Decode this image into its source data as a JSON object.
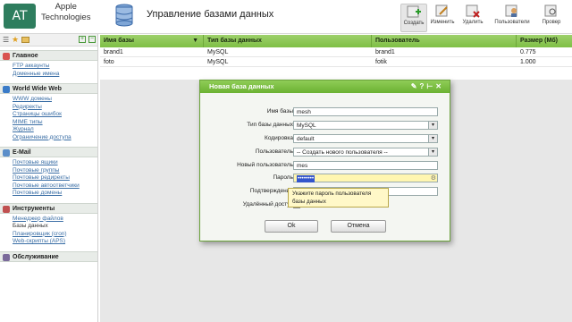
{
  "brand": {
    "logo": "AT",
    "line1": "Apple",
    "line2": "Technologies"
  },
  "page_title": "Управление базами данных",
  "toolbar": {
    "create": "Создать",
    "edit": "Изменить",
    "delete": "Удалить",
    "users": "Пользователи",
    "check": "Провер"
  },
  "sidebar": {
    "sections": [
      {
        "title": "Главное",
        "color": "#d9534f",
        "items": [
          "FTP аккаунты",
          "Доменные имена"
        ]
      },
      {
        "title": "World Wide Web",
        "color": "#3a7bc8",
        "items": [
          "WWW домены",
          "Редиректы",
          "Страницы ошибок",
          "MIME типы",
          "Журнал",
          "Ограничение доступа"
        ]
      },
      {
        "title": "E-Mail",
        "color": "#5b8ec9",
        "items": [
          "Почтовые ящики",
          "Почтовые группы",
          "Почтовые редиректы",
          "Почтовые автоответчики",
          "Почтовые домены"
        ]
      },
      {
        "title": "Инструменты",
        "color": "#c05050",
        "items": [
          "Менеджер файлов",
          "Базы данных",
          "Планировщик (cron)",
          "Web-скрипты (APS)"
        ]
      },
      {
        "title": "Обслуживание",
        "color": "#7a6a9a",
        "items": []
      }
    ]
  },
  "table": {
    "headers": [
      "Имя базы",
      "Тип базы данных",
      "Пользователь",
      "Размер (Мб)"
    ],
    "rows": [
      [
        "brand1",
        "MySQL",
        "brand1",
        "0.775"
      ],
      [
        "foto",
        "MySQL",
        "fotik",
        "1.000"
      ]
    ]
  },
  "dialog": {
    "title": "Новая база данных",
    "fields": [
      {
        "label": "Имя базы",
        "value": "mesh",
        "kind": "text"
      },
      {
        "label": "Тип базы данных",
        "value": "MySQL",
        "kind": "select"
      },
      {
        "label": "Кодировка",
        "value": "default",
        "kind": "select"
      },
      {
        "label": "Пользователь",
        "value": "-- Создать нового пользователя --",
        "kind": "select"
      },
      {
        "label": "Новый пользователь",
        "value": "mes",
        "kind": "text"
      },
      {
        "label": "Пароль",
        "value": "••••••••",
        "kind": "password"
      },
      {
        "label": "Подтверждение",
        "value": "",
        "kind": "password"
      },
      {
        "label": "Удалённый доступ",
        "value": "",
        "kind": "checkbox"
      }
    ],
    "tooltip": "Укажите пароль пользователя базы данных",
    "ok": "Ok",
    "cancel": "Отмена"
  }
}
